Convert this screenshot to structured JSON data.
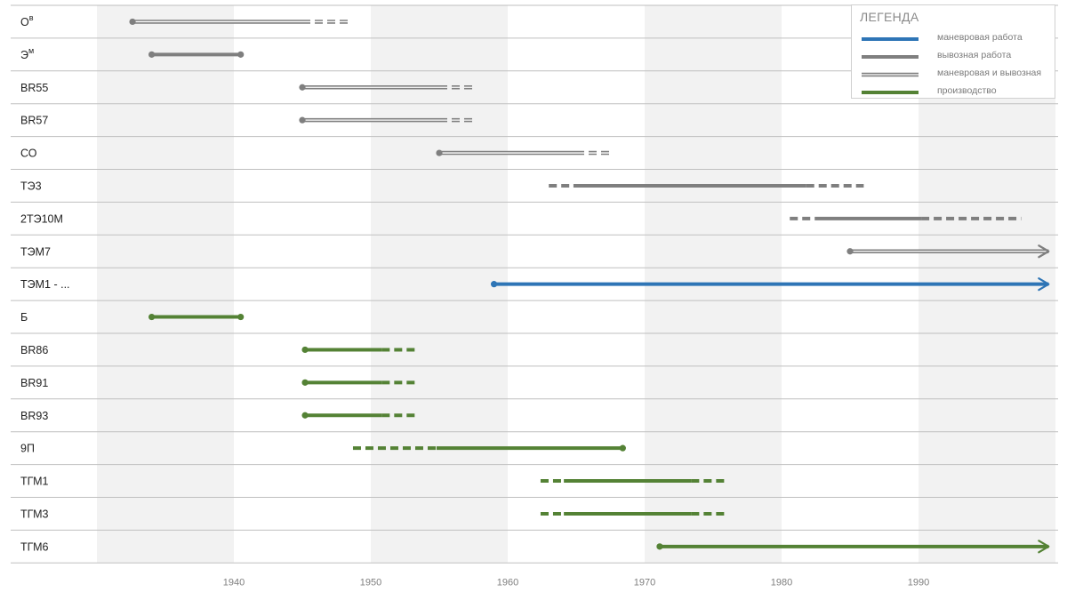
{
  "chart_data": {
    "type": "timeline",
    "x_ticks": [
      1940,
      1950,
      1960,
      1970,
      1980,
      1990
    ],
    "xlim": [
      1924,
      2001
    ],
    "grid": "alternating decade bands",
    "legend_placement": "top-right",
    "colors": {
      "shunting": "#2e75b6",
      "transfer": "#7f7f7f",
      "production": "#548235",
      "row_line": "#bfbfbf",
      "band": "#f2f2f2"
    },
    "legend": {
      "title": "ЛЕГЕНДА",
      "items": [
        {
          "label": "маневровая работа",
          "style": "blue"
        },
        {
          "label": "вывозная работа",
          "style": "gray"
        },
        {
          "label": "маневровая и вывозная",
          "style": "gray-double"
        },
        {
          "label": "производство",
          "style": "green"
        }
      ]
    },
    "rows": [
      {
        "label": "Ов",
        "label_main": "О",
        "label_sup": "в",
        "style": "gray-double",
        "start": 1932.6,
        "solid_end": 1945,
        "end": 1948.6,
        "start_dot": true
      },
      {
        "label": "Эм",
        "label_main": "Э",
        "label_sup": "м",
        "style": "gray",
        "start": 1934,
        "end": 1940.5,
        "start_dot": true,
        "end_dot": true
      },
      {
        "label": "BR55",
        "style": "gray-double",
        "start": 1945,
        "solid_end": 1955,
        "end": 1957.5,
        "start_dot": true
      },
      {
        "label": "BR57",
        "style": "gray-double",
        "start": 1945,
        "solid_end": 1955,
        "end": 1957.5,
        "start_dot": true
      },
      {
        "label": "СО",
        "style": "gray-double",
        "start": 1955,
        "solid_end": 1965,
        "end": 1967.6,
        "start_dot": true
      },
      {
        "label": "ТЭ3",
        "style": "gray",
        "dash_start": 1963,
        "start": 1964.8,
        "solid_end": 1981.8,
        "end": 1986
      },
      {
        "label": "2ТЭ10М",
        "style": "gray",
        "dash_start": 1980.6,
        "start": 1982.5,
        "solid_end": 1990.2,
        "end": 1997.5
      },
      {
        "label": "ТЭМ7",
        "style": "gray-double",
        "start": 1985,
        "end": 1999.5,
        "start_dot": true,
        "arrow": true
      },
      {
        "label": "ТЭМ1 - ...",
        "style": "blue",
        "start": 1959,
        "end": 1999.5,
        "start_dot": true,
        "arrow": true
      },
      {
        "label": "Б",
        "style": "green",
        "start": 1934,
        "end": 1940.5,
        "start_dot": true,
        "end_dot": true
      },
      {
        "label": "BR86",
        "style": "green",
        "start": 1945.2,
        "solid_end": 1950.8,
        "end": 1953.4,
        "start_dot": true
      },
      {
        "label": "BR91",
        "style": "green",
        "start": 1945.2,
        "solid_end": 1950.8,
        "end": 1953.4,
        "start_dot": true
      },
      {
        "label": "BR93",
        "style": "green",
        "start": 1945.2,
        "solid_end": 1950.8,
        "end": 1953.4,
        "start_dot": true
      },
      {
        "label": "9П",
        "style": "green",
        "dash_start": 1948.7,
        "start": 1954.8,
        "end": 1968.4,
        "end_dot": true
      },
      {
        "label": "ТГМ1",
        "style": "green",
        "dash_start": 1962.4,
        "start": 1964.1,
        "solid_end": 1973.4,
        "end": 1976
      },
      {
        "label": "ТГМ3",
        "style": "green",
        "dash_start": 1962.4,
        "start": 1964.1,
        "solid_end": 1973.4,
        "end": 1976
      },
      {
        "label": "ТГМ6",
        "style": "green",
        "start": 1971.1,
        "end": 1999.5,
        "start_dot": true,
        "arrow": true
      }
    ]
  }
}
